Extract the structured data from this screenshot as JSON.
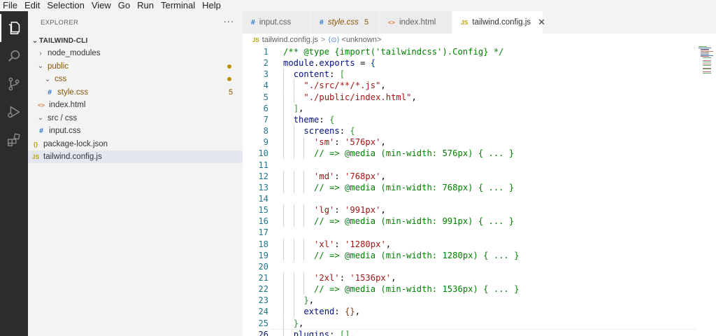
{
  "menu": [
    "File",
    "Edit",
    "Selection",
    "View",
    "Go",
    "Run",
    "Terminal",
    "Help"
  ],
  "activity": [
    "explorer-icon",
    "search-icon",
    "source-control-icon",
    "run-debug-icon",
    "extensions-icon"
  ],
  "sidebar": {
    "title": "EXPLORER",
    "more": "···",
    "root": "TAILWIND-CLI",
    "items": [
      {
        "label": "node_modules",
        "chevron": "›",
        "icon": "",
        "badge": ""
      },
      {
        "label": "public",
        "chevron": "⌄",
        "icon": "",
        "badge": "dot"
      },
      {
        "label": "css",
        "chevron": "⌄",
        "icon": "",
        "badge": "dot"
      },
      {
        "label": "style.css",
        "chevron": "",
        "icon": "#",
        "badge": "5"
      },
      {
        "label": "index.html",
        "chevron": "",
        "icon": "<>",
        "badge": ""
      },
      {
        "label": "src / css",
        "chevron": "⌄",
        "icon": "",
        "badge": ""
      },
      {
        "label": "input.css",
        "chevron": "",
        "icon": "#",
        "badge": ""
      },
      {
        "label": "package-lock.json",
        "chevron": "",
        "icon": "{}",
        "badge": ""
      },
      {
        "label": "tailwind.config.js",
        "chevron": "",
        "icon": "JS",
        "badge": ""
      }
    ]
  },
  "tabs": [
    {
      "label": "input.css",
      "icon": "#",
      "badge": "",
      "active": false
    },
    {
      "label": "style.css",
      "icon": "#",
      "badge": "5",
      "active": false
    },
    {
      "label": "index.html",
      "icon": "<>",
      "badge": "",
      "active": false
    },
    {
      "label": "tailwind.config.js",
      "icon": "JS",
      "badge": "",
      "active": true,
      "close": "✕"
    }
  ],
  "breadcrumb": {
    "file_icon": "JS",
    "file": "tailwind.config.js",
    "separator": ">",
    "symbol_icon": "⟨⊙⟩",
    "symbol": "<unknown>"
  },
  "editor": {
    "current_line": 26,
    "lines": [
      {
        "n": "1",
        "text": "/** @type {import('tailwindcss').Config} */"
      },
      {
        "n": "2",
        "text": "module.exports = {"
      },
      {
        "n": "3",
        "text": "  content: ["
      },
      {
        "n": "4",
        "text": "    \"./src/**/*.js\","
      },
      {
        "n": "5",
        "text": "    \"./public/index.html\","
      },
      {
        "n": "6",
        "text": "  ],"
      },
      {
        "n": "7",
        "text": "  theme: {"
      },
      {
        "n": "8",
        "text": "    screens: {"
      },
      {
        "n": "9",
        "text": "      'sm': '576px',"
      },
      {
        "n": "10",
        "text": "      // => @media (min-width: 576px) { ... }"
      },
      {
        "n": "11",
        "text": ""
      },
      {
        "n": "12",
        "text": "      'md': '768px',"
      },
      {
        "n": "13",
        "text": "      // => @media (min-width: 768px) { ... }"
      },
      {
        "n": "14",
        "text": ""
      },
      {
        "n": "15",
        "text": "      'lg': '991px',"
      },
      {
        "n": "16",
        "text": "      // => @media (min-width: 991px) { ... }"
      },
      {
        "n": "17",
        "text": ""
      },
      {
        "n": "18",
        "text": "      'xl': '1280px',"
      },
      {
        "n": "19",
        "text": "      // => @media (min-width: 1280px) { ... }"
      },
      {
        "n": "20",
        "text": ""
      },
      {
        "n": "21",
        "text": "      '2xl': '1536px',"
      },
      {
        "n": "22",
        "text": "      // => @media (min-width: 1536px) { ... }"
      },
      {
        "n": "23",
        "text": "    },"
      },
      {
        "n": "24",
        "text": "    extend: {},"
      },
      {
        "n": "25",
        "text": "  },"
      },
      {
        "n": "26",
        "text": "  plugins: [],"
      }
    ]
  },
  "colors": {
    "activity_bar": "#2c2c2c",
    "sidebar": "#f3f3f3",
    "comment": "#008000",
    "string": "#a31515",
    "property": "#0451a5",
    "line_number": "#237893"
  }
}
